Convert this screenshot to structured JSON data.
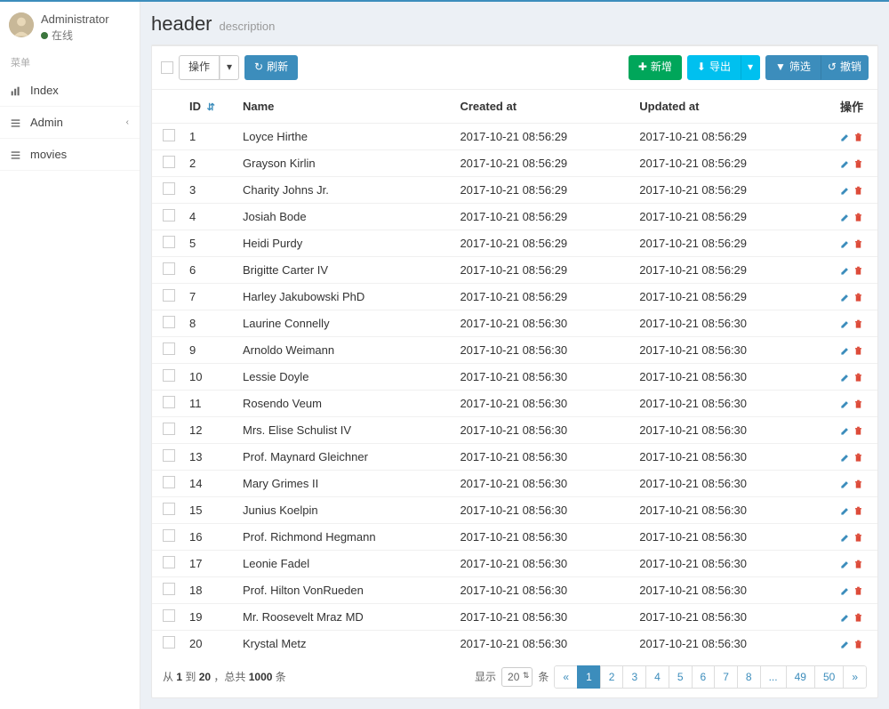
{
  "user": {
    "name": "Administrator",
    "status": "在线"
  },
  "sidebar": {
    "menu_header": "菜单",
    "items": [
      {
        "icon": "bar-chart",
        "label": "Index"
      },
      {
        "icon": "list",
        "label": "Admin",
        "has_children": true
      },
      {
        "icon": "list",
        "label": "movies"
      }
    ]
  },
  "header": {
    "title": "header",
    "description": "description"
  },
  "toolbar": {
    "action": "操作",
    "refresh": "刷新",
    "new": "新增",
    "export": "导出",
    "filter": "筛选",
    "undo": "撤销"
  },
  "columns": {
    "id": "ID",
    "name": "Name",
    "created": "Created at",
    "updated": "Updated at",
    "actions": "操作"
  },
  "rows": [
    {
      "id": "1",
      "name": "Loyce Hirthe",
      "created": "2017-10-21 08:56:29",
      "updated": "2017-10-21 08:56:29"
    },
    {
      "id": "2",
      "name": "Grayson Kirlin",
      "created": "2017-10-21 08:56:29",
      "updated": "2017-10-21 08:56:29"
    },
    {
      "id": "3",
      "name": "Charity Johns Jr.",
      "created": "2017-10-21 08:56:29",
      "updated": "2017-10-21 08:56:29"
    },
    {
      "id": "4",
      "name": "Josiah Bode",
      "created": "2017-10-21 08:56:29",
      "updated": "2017-10-21 08:56:29"
    },
    {
      "id": "5",
      "name": "Heidi Purdy",
      "created": "2017-10-21 08:56:29",
      "updated": "2017-10-21 08:56:29"
    },
    {
      "id": "6",
      "name": "Brigitte Carter IV",
      "created": "2017-10-21 08:56:29",
      "updated": "2017-10-21 08:56:29"
    },
    {
      "id": "7",
      "name": "Harley Jakubowski PhD",
      "created": "2017-10-21 08:56:29",
      "updated": "2017-10-21 08:56:29"
    },
    {
      "id": "8",
      "name": "Laurine Connelly",
      "created": "2017-10-21 08:56:30",
      "updated": "2017-10-21 08:56:30"
    },
    {
      "id": "9",
      "name": "Arnoldo Weimann",
      "created": "2017-10-21 08:56:30",
      "updated": "2017-10-21 08:56:30"
    },
    {
      "id": "10",
      "name": "Lessie Doyle",
      "created": "2017-10-21 08:56:30",
      "updated": "2017-10-21 08:56:30"
    },
    {
      "id": "11",
      "name": "Rosendo Veum",
      "created": "2017-10-21 08:56:30",
      "updated": "2017-10-21 08:56:30"
    },
    {
      "id": "12",
      "name": "Mrs. Elise Schulist IV",
      "created": "2017-10-21 08:56:30",
      "updated": "2017-10-21 08:56:30"
    },
    {
      "id": "13",
      "name": "Prof. Maynard Gleichner",
      "created": "2017-10-21 08:56:30",
      "updated": "2017-10-21 08:56:30"
    },
    {
      "id": "14",
      "name": "Mary Grimes II",
      "created": "2017-10-21 08:56:30",
      "updated": "2017-10-21 08:56:30"
    },
    {
      "id": "15",
      "name": "Junius Koelpin",
      "created": "2017-10-21 08:56:30",
      "updated": "2017-10-21 08:56:30"
    },
    {
      "id": "16",
      "name": "Prof. Richmond Hegmann",
      "created": "2017-10-21 08:56:30",
      "updated": "2017-10-21 08:56:30"
    },
    {
      "id": "17",
      "name": "Leonie Fadel",
      "created": "2017-10-21 08:56:30",
      "updated": "2017-10-21 08:56:30"
    },
    {
      "id": "18",
      "name": "Prof. Hilton VonRueden",
      "created": "2017-10-21 08:56:30",
      "updated": "2017-10-21 08:56:30"
    },
    {
      "id": "19",
      "name": "Mr. Roosevelt Mraz MD",
      "created": "2017-10-21 08:56:30",
      "updated": "2017-10-21 08:56:30"
    },
    {
      "id": "20",
      "name": "Krystal Metz",
      "created": "2017-10-21 08:56:30",
      "updated": "2017-10-21 08:56:30"
    }
  ],
  "footer": {
    "from": "1",
    "to": "20",
    "total": "1000",
    "text_prefix": "从 ",
    "text_to": " 到 ",
    "text_sep": " ，总共 ",
    "text_suffix": " 条",
    "show_label": "显示",
    "entries_label": "条",
    "per_page": "20"
  },
  "pagination": {
    "pages": [
      "«",
      "1",
      "2",
      "3",
      "4",
      "5",
      "6",
      "7",
      "8",
      "...",
      "49",
      "50",
      "»"
    ],
    "active_index": 1
  }
}
